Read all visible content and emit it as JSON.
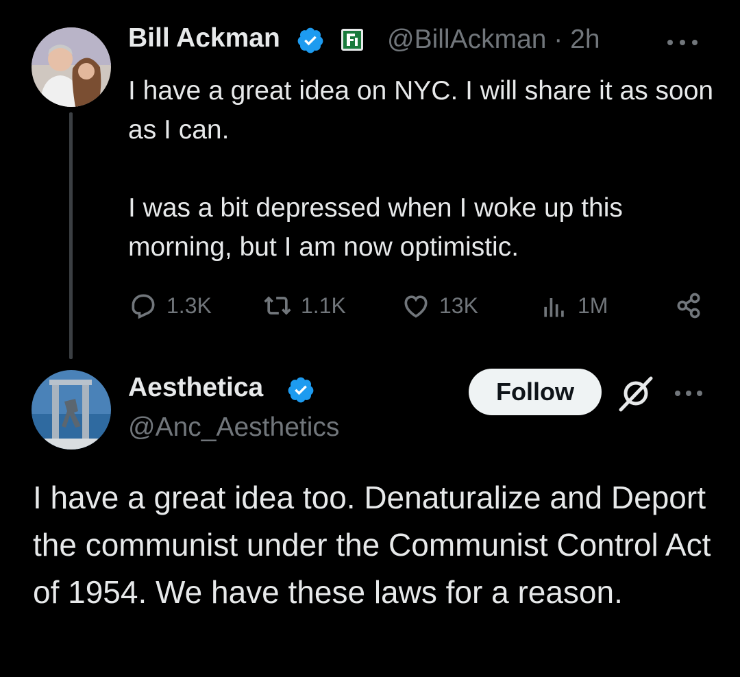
{
  "tweet1": {
    "author_name": "Bill Ackman",
    "handle_time": "@BillAckman · 2h",
    "paragraphs": [
      "I have a great idea on NYC. I will share it as soon as I can.",
      "I was a bit depressed when I woke up this morning, but I am now optimistic."
    ],
    "stats": {
      "replies": "1.3K",
      "retweets": "1.1K",
      "likes": "13K",
      "views": "1M"
    }
  },
  "tweet2": {
    "author_name": "Aesthetica",
    "handle": "@Anc_Aesthetics",
    "follow_label": "Follow",
    "text": "I have a great idea too. Denaturalize and Deport the communist under the Communist Control Act of 1954. We have these laws for a reason."
  },
  "colors": {
    "background": "#000000",
    "text_primary": "#e7e9ea",
    "text_secondary": "#71767b",
    "verified_blue": "#1d9bf0",
    "follow_bg": "#eff3f4"
  },
  "icons": [
    "reply-icon",
    "retweet-icon",
    "like-icon",
    "views-icon",
    "share-icon",
    "verified-icon",
    "more-icon",
    "grok-icon"
  ]
}
